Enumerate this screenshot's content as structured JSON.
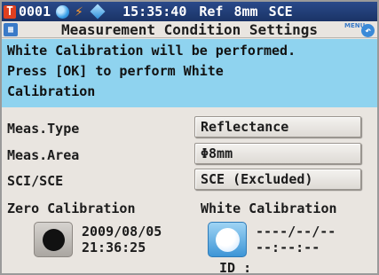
{
  "status": {
    "measurement_no": "0001",
    "time": "15:35:40",
    "target": "Ref",
    "area": "8mm",
    "mode": "SCE"
  },
  "title": "Measurement Condition Settings",
  "menu_label": "MENU",
  "message": {
    "line1": "White Calibration will be performed.",
    "line2": "Press [OK] to perform White",
    "line3": "Calibration"
  },
  "settings": [
    {
      "label": "Meas.Type",
      "value": "Reflectance"
    },
    {
      "label": "Meas.Area",
      "value": "Φ8mm"
    },
    {
      "label": "SCI/SCE",
      "value": "SCE (Excluded)"
    }
  ],
  "zero_cal": {
    "heading": "Zero Calibration",
    "date": "2009/08/05",
    "time": "21:36:25"
  },
  "white_cal": {
    "heading": "White Calibration",
    "date": "----/--/--",
    "time": "--:--:--",
    "id_label": "ID :"
  },
  "icons": {
    "status": [
      "thermometer-icon",
      "globe-icon",
      "battery-bolt-icon",
      "diamond-icon"
    ],
    "title": "settings-screen-icon",
    "menu": "menu-return-icon"
  },
  "colors": {
    "status_bar": "#1a3366",
    "message_panel": "#8fd3ef",
    "screen_bg": "#e9e5e0",
    "white_cal_button": "#3d95d6"
  }
}
